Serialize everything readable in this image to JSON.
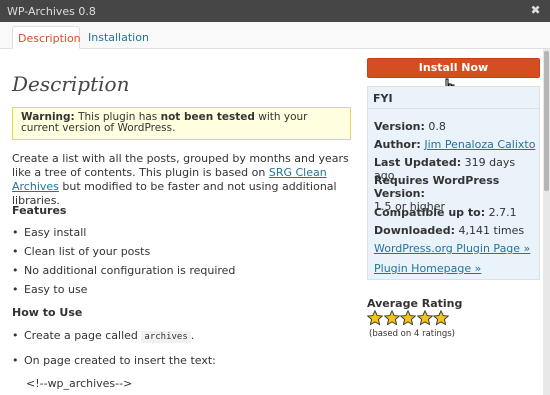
{
  "window": {
    "title": "WP-Archives 0.8",
    "close_label": "✖"
  },
  "tabs": [
    {
      "label": "Description",
      "active": true
    },
    {
      "label": "Installation",
      "active": false
    }
  ],
  "main": {
    "title": "Description",
    "warning": {
      "prefix": "Warning:",
      "text1": " This plugin has ",
      "bold": "not been tested",
      "text2": " with your current version of WordPress."
    },
    "intro": {
      "part1": "Create a list with all the posts, grouped by months and years like a tree of contents. This plugin is based on ",
      "link": "SRG Clean Archives",
      "part2": " but modified to be faster and not using additional libraries."
    },
    "features_heading": "Features",
    "features": [
      "Easy install",
      "Clean list of your posts",
      "No additional configuration is required",
      "Easy to use"
    ],
    "howto_heading": "How to Use",
    "howto": [
      {
        "before": "Create a page called ",
        "code": "archives",
        "after": "."
      },
      {
        "before": "On page created to insert the text:",
        "code": "",
        "after": ""
      }
    ],
    "code_sample": "<!--wp_archives-->"
  },
  "sidebar": {
    "install_label": "Install Now",
    "fyi_heading": "FYI",
    "version_label": "Version:",
    "version": "0.8",
    "author_label": "Author:",
    "author": "Jim Penaloza Calixto",
    "updated_label": "Last Updated:",
    "updated": "319 days ago",
    "requires_label": "Requires WordPress Version:",
    "requires": "1.5 or higher",
    "compatible_label": "Compatible up to:",
    "compatible": "2.7.1",
    "downloads_label": "Downloaded:",
    "downloads": "4,141 times",
    "link_wporg": "WordPress.org Plugin Page »",
    "link_homepage": "Plugin Homepage »",
    "rating_heading": "Average Rating",
    "rating": 5,
    "rating_count": "(based on 4 ratings)"
  },
  "colors": {
    "accent": "#d54e21",
    "link": "#21759b",
    "fyi_bg": "#eaf3fa",
    "warning_bg": "#ffffe0",
    "star": "#f2c51d"
  }
}
